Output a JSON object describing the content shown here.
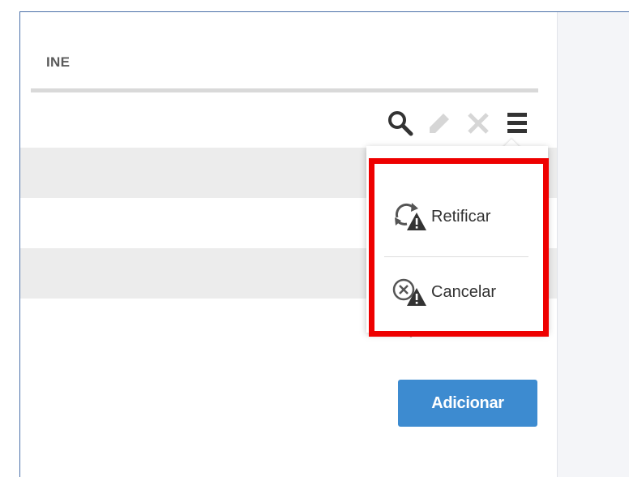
{
  "table": {
    "column_header": "INE",
    "row_count": 5
  },
  "row_actions": {
    "icons": [
      "search-icon",
      "edit-icon",
      "delete-icon",
      "menu-icon"
    ]
  },
  "dropdown": {
    "items": [
      {
        "label": "Retificar",
        "icon": "rectify-warning-icon"
      },
      {
        "label": "Cancelar",
        "icon": "cancel-warning-icon"
      }
    ]
  },
  "buttons": {
    "add_label": "Adicionar"
  },
  "colors": {
    "highlight": "#ee0000",
    "button": "#3d8bd0",
    "row_stripe": "#ececec"
  }
}
